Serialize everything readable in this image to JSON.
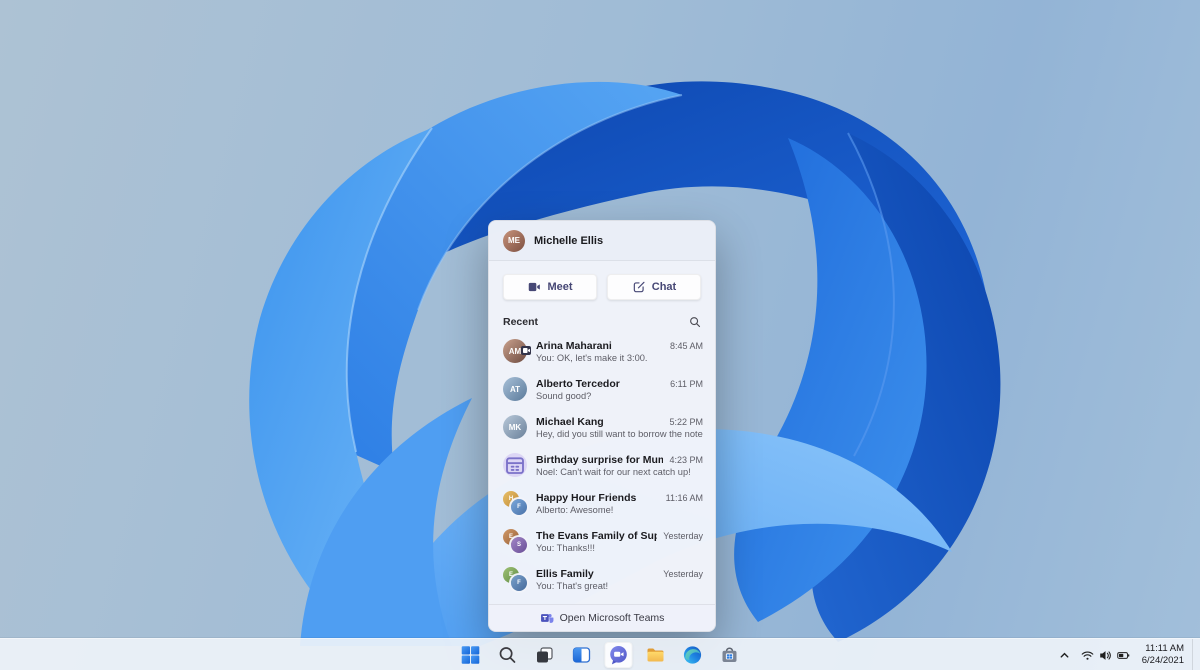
{
  "colors": {
    "desktop_blue_deep": "#0d47b0",
    "desktop_blue_mid": "#1e6ada",
    "desktop_blue_bright": "#3f93ee",
    "desktop_blue_light": "#71b8f7",
    "teams_purple": "#464775",
    "teams_bubble": "#6b73e0",
    "panel_bg": "#f2f4fa",
    "taskbar_bg": "#f0f4fa",
    "folder_yellow": "#ffd96a",
    "start_blue": "#2f7fe3"
  },
  "flyout": {
    "header": {
      "name": "Michelle Ellis",
      "avatar_text": "ME",
      "avatar_bg": "linear-gradient(135deg,#c8937b,#7d4f41)"
    },
    "buttons": {
      "meet": "Meet",
      "chat": "Chat"
    },
    "recent_label": "Recent",
    "conversations": [
      {
        "name": "Arina Maharani",
        "preview": "You: OK, let's make it 3:00.",
        "time": "8:45 AM",
        "avatar_text": "AM",
        "avatar_bg": "linear-gradient(135deg,#caa28e,#6d4a3f)",
        "badge": "video-call"
      },
      {
        "name": "Alberto Tercedor",
        "preview": "Sound good?",
        "time": "6:11 PM",
        "avatar_text": "AT",
        "avatar_bg": "linear-gradient(135deg,#a8c0d8,#5a7a9a)"
      },
      {
        "name": "Michael Kang",
        "preview": "Hey, did you still want to borrow the notes?",
        "time": "5:22 PM",
        "avatar_text": "MK",
        "avatar_bg": "linear-gradient(135deg,#b9c9d9,#69809a)"
      },
      {
        "name": "Birthday surprise for Mum",
        "preview": "Noel: Can't wait for our next catch up!",
        "time": "4:23 PM",
        "avatar_text": "",
        "avatar_kind": "calendar",
        "avatar_bg": "#dcd6f5"
      },
      {
        "name": "Happy Hour Friends",
        "preview": "Alberto: Awesome!",
        "time": "11:16 AM",
        "avatar_text": "H",
        "avatar_bg": "linear-gradient(135deg,#e8c06a,#c08a35)",
        "avatar_text2": "F",
        "avatar_bg2": "linear-gradient(135deg,#7aa8dc,#4a72a8)"
      },
      {
        "name": "The Evans Family of Supers",
        "preview": "You: Thanks!!!",
        "time": "Yesterday",
        "avatar_text": "E",
        "avatar_bg": "linear-gradient(135deg,#d09a6a,#985f34)",
        "avatar_text2": "S",
        "avatar_bg2": "linear-gradient(135deg,#a287c8,#6a4f96)"
      },
      {
        "name": "Ellis Family",
        "preview": "You: That's great!",
        "time": "Yesterday",
        "avatar_text": "E",
        "avatar_bg": "linear-gradient(135deg,#9fc276,#5f8a42)",
        "avatar_text2": "F",
        "avatar_bg2": "linear-gradient(135deg,#7aa2cc,#46699a)"
      }
    ],
    "footer_label": "Open Microsoft Teams"
  },
  "taskbar": {
    "icons": [
      {
        "name": "start"
      },
      {
        "name": "search"
      },
      {
        "name": "task-view"
      },
      {
        "name": "widgets"
      },
      {
        "name": "chat-teams",
        "active": true
      },
      {
        "name": "file-explorer"
      },
      {
        "name": "edge"
      },
      {
        "name": "store"
      }
    ],
    "tray": {
      "hidden_icons": "chevron-up",
      "network": "wifi",
      "sound": "volume",
      "power": "battery",
      "time": "11:11 AM",
      "date": "6/24/2021"
    }
  }
}
